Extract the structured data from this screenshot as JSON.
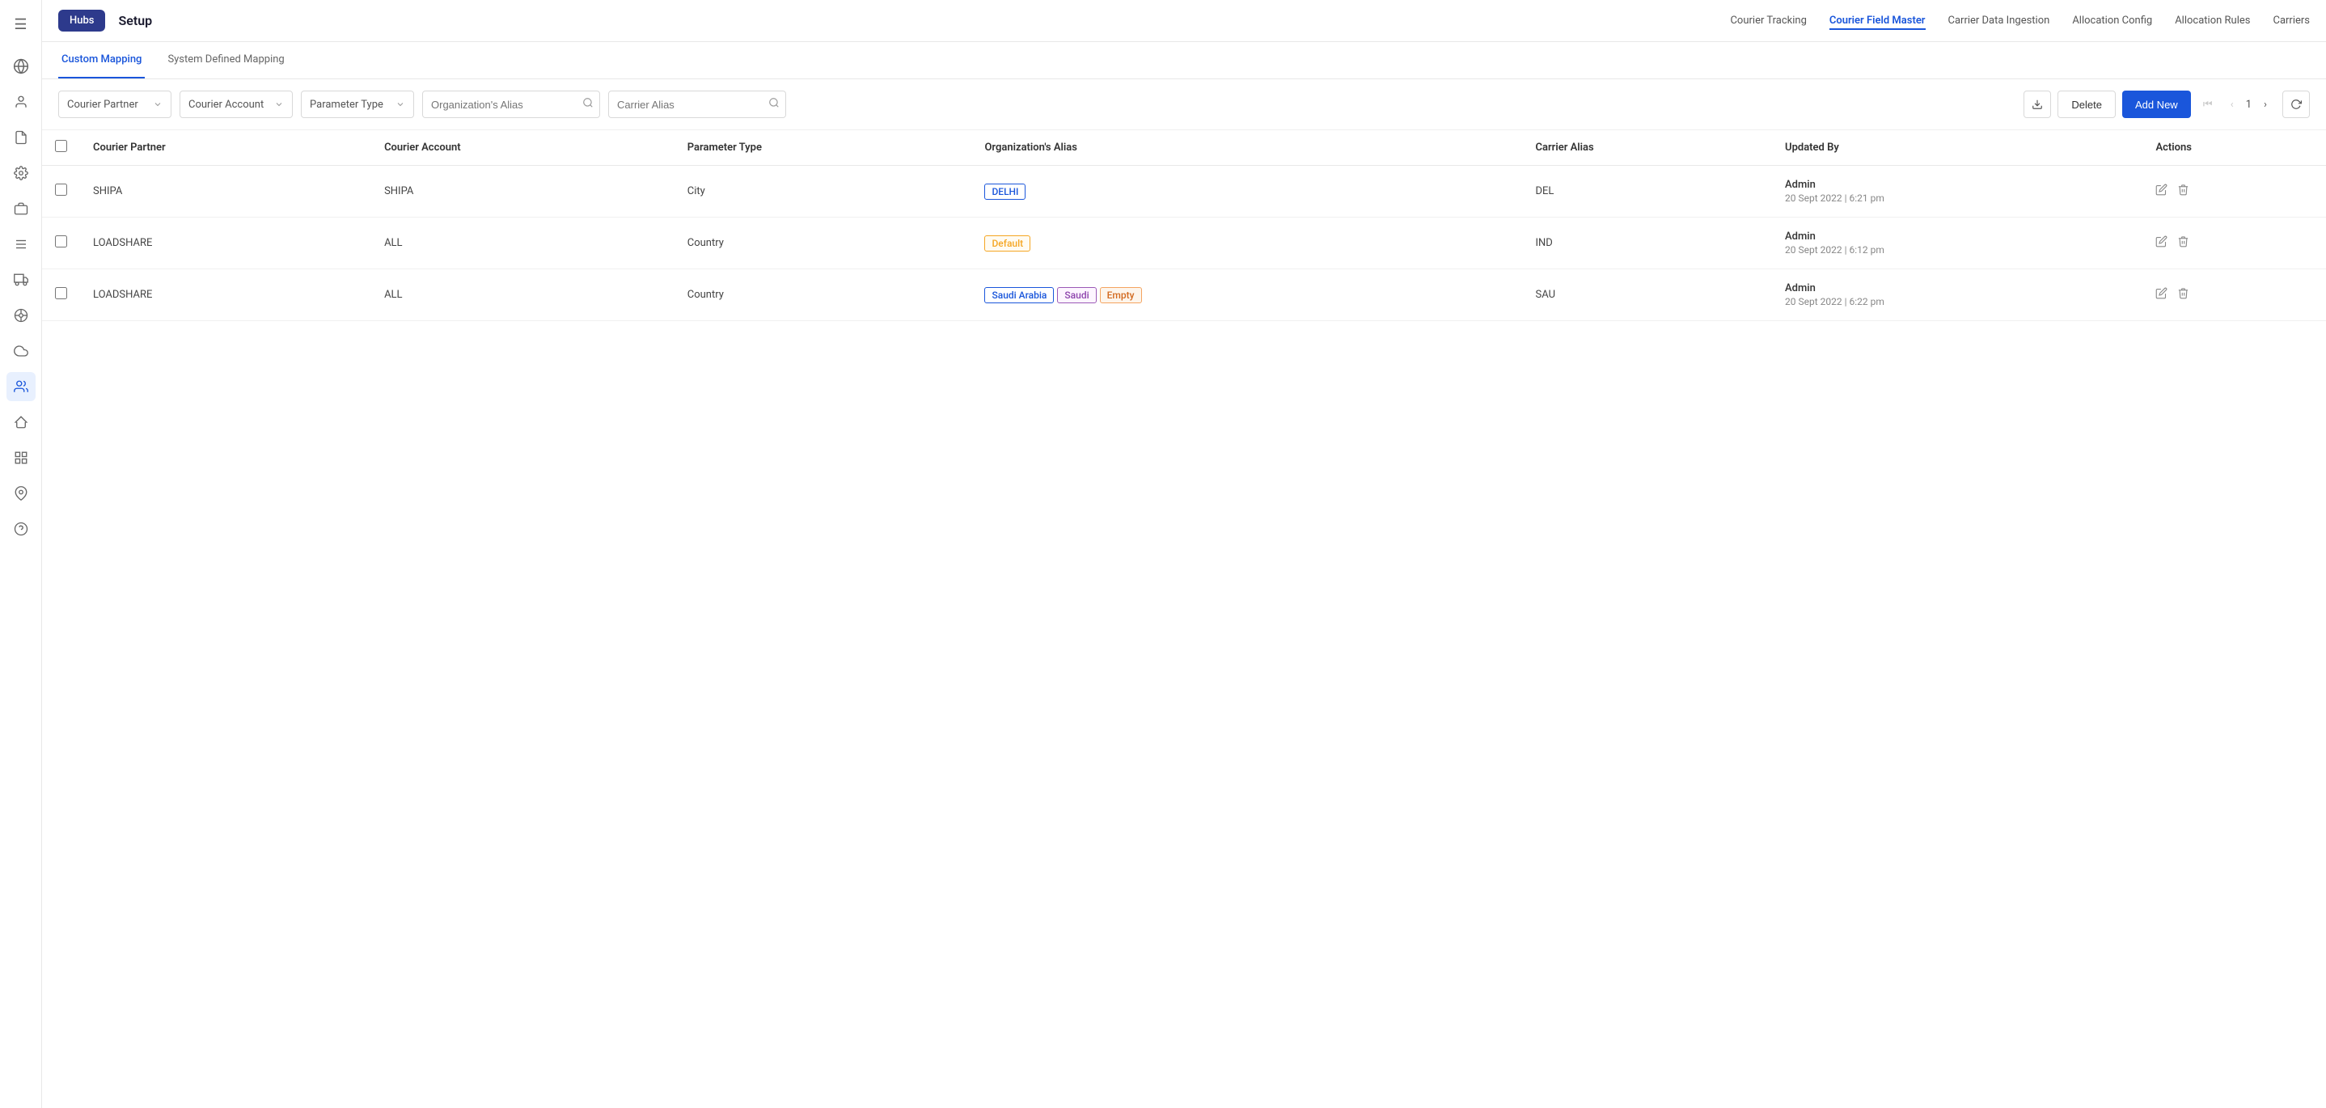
{
  "app": {
    "title": "Setup"
  },
  "sidebar": {
    "icons": [
      {
        "name": "menu-icon",
        "symbol": "☰",
        "active": false
      },
      {
        "name": "globe-icon",
        "symbol": "🌐",
        "active": false
      },
      {
        "name": "user-icon",
        "symbol": "👤",
        "active": false
      },
      {
        "name": "document-icon",
        "symbol": "📄",
        "active": false
      },
      {
        "name": "gear-icon",
        "symbol": "⚙",
        "active": false
      },
      {
        "name": "briefcase-icon",
        "symbol": "💼",
        "active": false
      },
      {
        "name": "settings2-icon",
        "symbol": "🔧",
        "active": false
      },
      {
        "name": "truck-icon",
        "symbol": "🚚",
        "active": false
      },
      {
        "name": "steering-icon",
        "symbol": "🎯",
        "active": false
      },
      {
        "name": "cloud-icon",
        "symbol": "☁",
        "active": false
      },
      {
        "name": "people-icon",
        "symbol": "👥",
        "active": true
      },
      {
        "name": "delivery-icon",
        "symbol": "📦",
        "active": false
      },
      {
        "name": "grid-icon",
        "symbol": "⊞",
        "active": false
      },
      {
        "name": "pin-icon",
        "symbol": "📍",
        "active": false
      },
      {
        "name": "support-icon",
        "symbol": "🛟",
        "active": false
      }
    ]
  },
  "topbar": {
    "title": "Setup",
    "hubs_label": "Hubs",
    "nav_items": [
      {
        "label": "Courier Tracking",
        "active": false
      },
      {
        "label": "Courier Field Master",
        "active": true
      },
      {
        "label": "Carrier Data Ingestion",
        "active": false
      },
      {
        "label": "Allocation Config",
        "active": false
      },
      {
        "label": "Allocation Rules",
        "active": false
      },
      {
        "label": "Carriers",
        "active": false
      }
    ]
  },
  "tabs": [
    {
      "label": "Custom Mapping",
      "active": true
    },
    {
      "label": "System Defined Mapping",
      "active": false
    }
  ],
  "filters": {
    "courier_partner": {
      "placeholder": "Courier Partner"
    },
    "courier_account": {
      "placeholder": "Courier Account"
    },
    "parameter_type": {
      "placeholder": "Parameter Type"
    },
    "org_alias": {
      "placeholder": "Organization's Alias"
    },
    "carrier_alias": {
      "placeholder": "Carrier Alias"
    },
    "delete_label": "Delete",
    "add_new_label": "Add New",
    "page_current": "1"
  },
  "table": {
    "columns": [
      "Courier Partner",
      "Courier Account",
      "Parameter Type",
      "Organization's Alias",
      "Carrier Alias",
      "Updated By",
      "Actions"
    ],
    "rows": [
      {
        "courier_partner": "SHIPA",
        "courier_account": "SHIPA",
        "parameter_type": "City",
        "org_alias_tags": [
          {
            "text": "DELHI",
            "type": "blue"
          }
        ],
        "carrier_alias": "DEL",
        "updated_by_name": "Admin",
        "updated_by_date": "20 Sept 2022 | 6:21 pm"
      },
      {
        "courier_partner": "LOADSHARE",
        "courier_account": "ALL",
        "parameter_type": "Country",
        "org_alias_tags": [
          {
            "text": "Default",
            "type": "default"
          }
        ],
        "carrier_alias": "IND",
        "updated_by_name": "Admin",
        "updated_by_date": "20 Sept 2022 | 6:12 pm"
      },
      {
        "courier_partner": "LOADSHARE",
        "courier_account": "ALL",
        "parameter_type": "Country",
        "org_alias_tags": [
          {
            "text": "Saudi Arabia",
            "type": "blue"
          },
          {
            "text": "Saudi",
            "type": "saudi"
          },
          {
            "text": "Empty",
            "type": "empty"
          }
        ],
        "carrier_alias": "SAU",
        "updated_by_name": "Admin",
        "updated_by_date": "20 Sept 2022 | 6:22 pm"
      }
    ]
  }
}
